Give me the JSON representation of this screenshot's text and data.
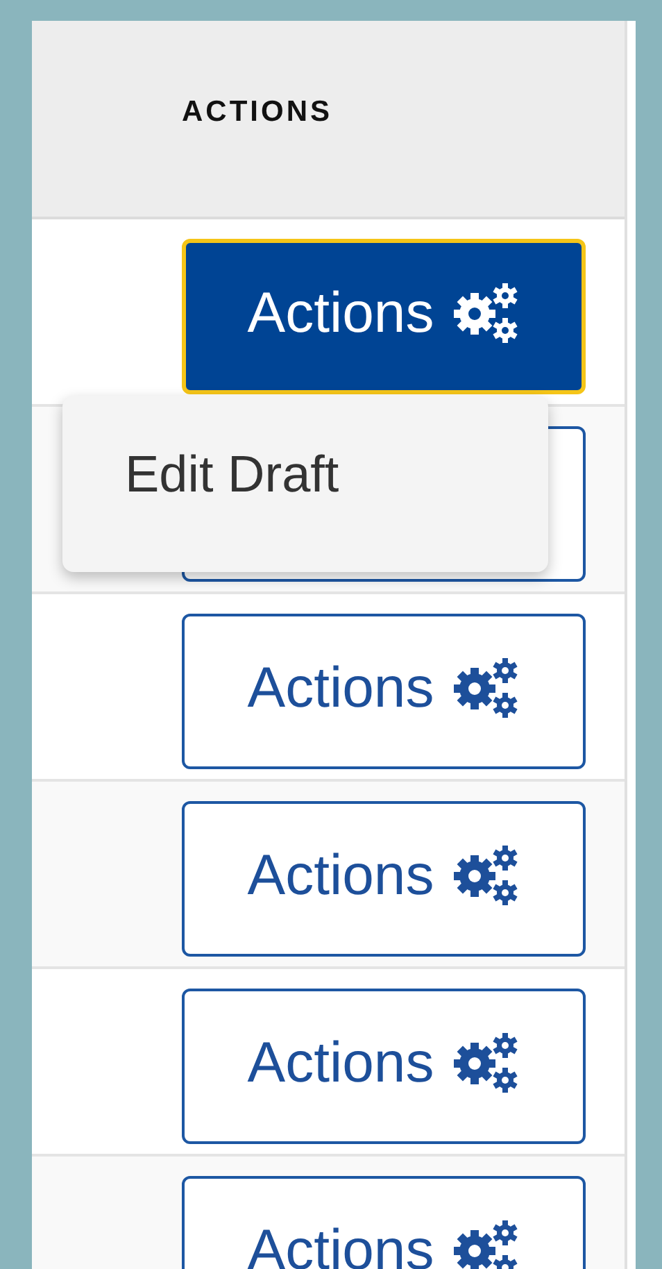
{
  "table": {
    "column": "ACTIONS",
    "rows": [
      {
        "label": "Actions",
        "focused": true
      },
      {
        "focused": false
      },
      {
        "label": "Actions",
        "focused": false
      },
      {
        "label": "Actions",
        "focused": false
      },
      {
        "label": "Actions",
        "focused": false
      },
      {
        "label": "Actions",
        "focused": false
      }
    ]
  },
  "menu": {
    "items": [
      "Edit Draft"
    ]
  }
}
